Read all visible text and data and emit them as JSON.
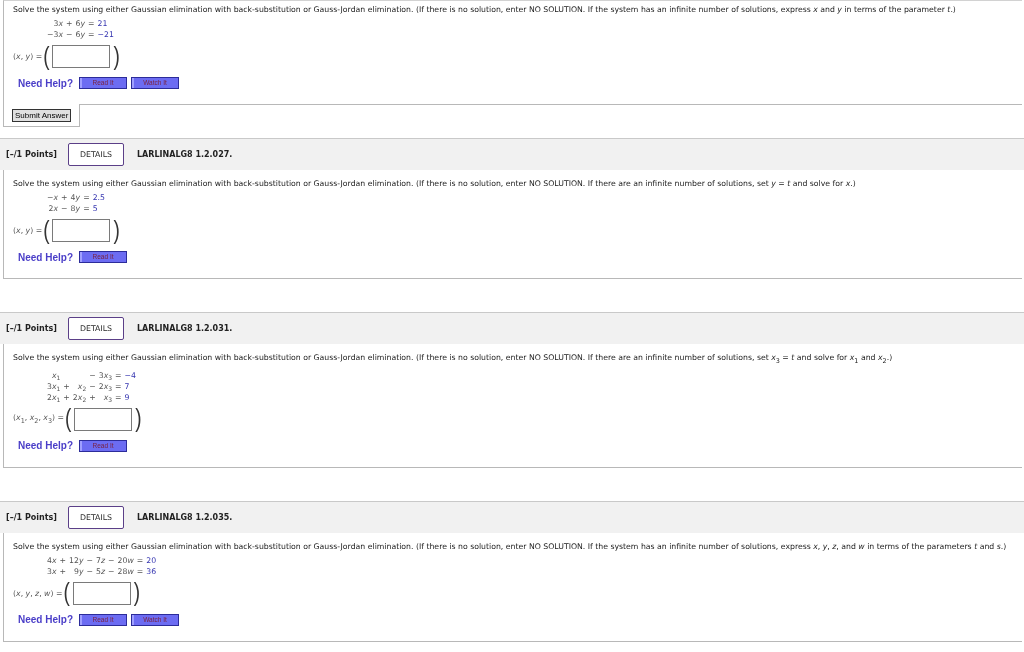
{
  "questions": [
    {
      "instructions": "Solve the system using either Gaussian elimination with back-substitution or Gauss-Jordan elimination. (If there is no solution, enter NO SOLUTION. If the system has an infinite number of solutions, express *x* and *y* in terms of the parameter *t*.)",
      "system": [
        {
          "terms": [
            {
              "kind": "term",
              "coef": "3",
              "var": "x"
            },
            {
              "kind": "term",
              "sign": "+",
              "coef": "6",
              "var": "y"
            }
          ],
          "relation": "=",
          "rhs": "21"
        },
        {
          "terms": [
            {
              "kind": "term",
              "coef": "−3",
              "var": "x"
            },
            {
              "kind": "term",
              "sign": "−",
              "coef": "6",
              "var": "y"
            }
          ],
          "relation": "=",
          "rhs": "−21"
        }
      ],
      "answer": {
        "label": "(*x*, *y*) =",
        "open": "(",
        "close": ")"
      },
      "help": {
        "label": "Need Help?",
        "buttons": [
          "Read It",
          "Watch It"
        ]
      },
      "submit": "Submit Answer"
    },
    {
      "header": {
        "points": "[–/1 Points]",
        "details": "DETAILS",
        "code": "LARLINALG8 1.2.027."
      },
      "instructions": "Solve the system using either Gaussian elimination with back-substitution or Gauss-Jordan elimination. (If there is no solution, enter NO SOLUTION. If there are an infinite number of solutions, set *y* = *t* and solve for *x*.)",
      "system": [
        {
          "terms": [
            {
              "kind": "term",
              "coef": "−",
              "var": "x"
            },
            {
              "kind": "term",
              "sign": "+",
              "coef": "4",
              "var": "y"
            }
          ],
          "relation": "=",
          "rhs": "2.5"
        },
        {
          "terms": [
            {
              "kind": "term",
              "coef": "2",
              "var": "x"
            },
            {
              "kind": "term",
              "sign": "−",
              "coef": "8",
              "var": "y"
            }
          ],
          "relation": "=",
          "rhs": "5"
        }
      ],
      "answer": {
        "label": "(*x*, *y*) =",
        "open": "(",
        "close": ")"
      },
      "help": {
        "label": "Need Help?",
        "buttons": [
          "Read It"
        ]
      }
    },
    {
      "header": {
        "points": "[–/1 Points]",
        "details": "DETAILS",
        "code": "LARLINALG8 1.2.031."
      },
      "instructions": "Solve the system using either Gaussian elimination with back-substitution or Gauss-Jordan elimination. (If there is no solution, enter NO SOLUTION. If there are an infinite number of solutions, set *x*$_{3}$ = *t* and solve for *x*$_{1}$ and *x*$_{2}$.)",
      "system": [
        {
          "terms": [
            {
              "kind": "term",
              "var": "x",
              "sub": "1"
            },
            {
              "kind": "gap"
            },
            {
              "kind": "term",
              "sign": "−",
              "coef": "3",
              "var": "x",
              "sub": "3"
            }
          ],
          "relation": "=",
          "rhs": "−4"
        },
        {
          "terms": [
            {
              "kind": "term",
              "coef": "3",
              "var": "x",
              "sub": "1"
            },
            {
              "kind": "term",
              "sign": "+",
              "var": "x",
              "sub": "2"
            },
            {
              "kind": "term",
              "sign": "−",
              "coef": "2",
              "var": "x",
              "sub": "3"
            }
          ],
          "relation": "=",
          "rhs": "7"
        },
        {
          "terms": [
            {
              "kind": "term",
              "coef": "2",
              "var": "x",
              "sub": "1"
            },
            {
              "kind": "term",
              "sign": "+",
              "coef": "2",
              "var": "x",
              "sub": "2"
            },
            {
              "kind": "term",
              "sign": "+",
              "var": "x",
              "sub": "3"
            }
          ],
          "relation": "=",
          "rhs": "9"
        }
      ],
      "answer": {
        "label": "(*x*$_{1}$, *x*$_{2}$, *x*$_{3}$) =",
        "open": "(",
        "close": ")"
      },
      "help": {
        "label": "Need Help?",
        "buttons": [
          "Read It"
        ]
      }
    },
    {
      "header": {
        "points": "[–/1 Points]",
        "details": "DETAILS",
        "code": "LARLINALG8 1.2.035."
      },
      "instructions": "Solve the system using either Gaussian elimination with back-substitution or Gauss-Jordan elimination. (If there is no solution, enter NO SOLUTION. If the system has an infinite number of solutions, express *x*, *y*, *z*, and *w* in terms of the parameters *t* and *s*.)",
      "system": [
        {
          "terms": [
            {
              "kind": "term",
              "coef": "4",
              "var": "x"
            },
            {
              "kind": "term",
              "sign": "+",
              "coef": "12",
              "var": "y"
            },
            {
              "kind": "term",
              "sign": "−",
              "coef": "7",
              "var": "z"
            },
            {
              "kind": "term",
              "sign": "−",
              "coef": "20",
              "var": "w"
            }
          ],
          "relation": "=",
          "rhs": "20"
        },
        {
          "terms": [
            {
              "kind": "term",
              "coef": "3",
              "var": "x"
            },
            {
              "kind": "term",
              "sign": "+",
              "coef": "9",
              "var": "y"
            },
            {
              "kind": "term",
              "sign": "−",
              "coef": "5",
              "var": "z"
            },
            {
              "kind": "term",
              "sign": "−",
              "coef": "28",
              "var": "w"
            }
          ],
          "relation": "=",
          "rhs": "36"
        }
      ],
      "answer": {
        "label": "(*x*, *y*, *z*, *w*) =",
        "open": "(",
        "close": ")"
      },
      "help": {
        "label": "Need Help?",
        "buttons": [
          "Read It",
          "Watch It"
        ]
      }
    }
  ]
}
